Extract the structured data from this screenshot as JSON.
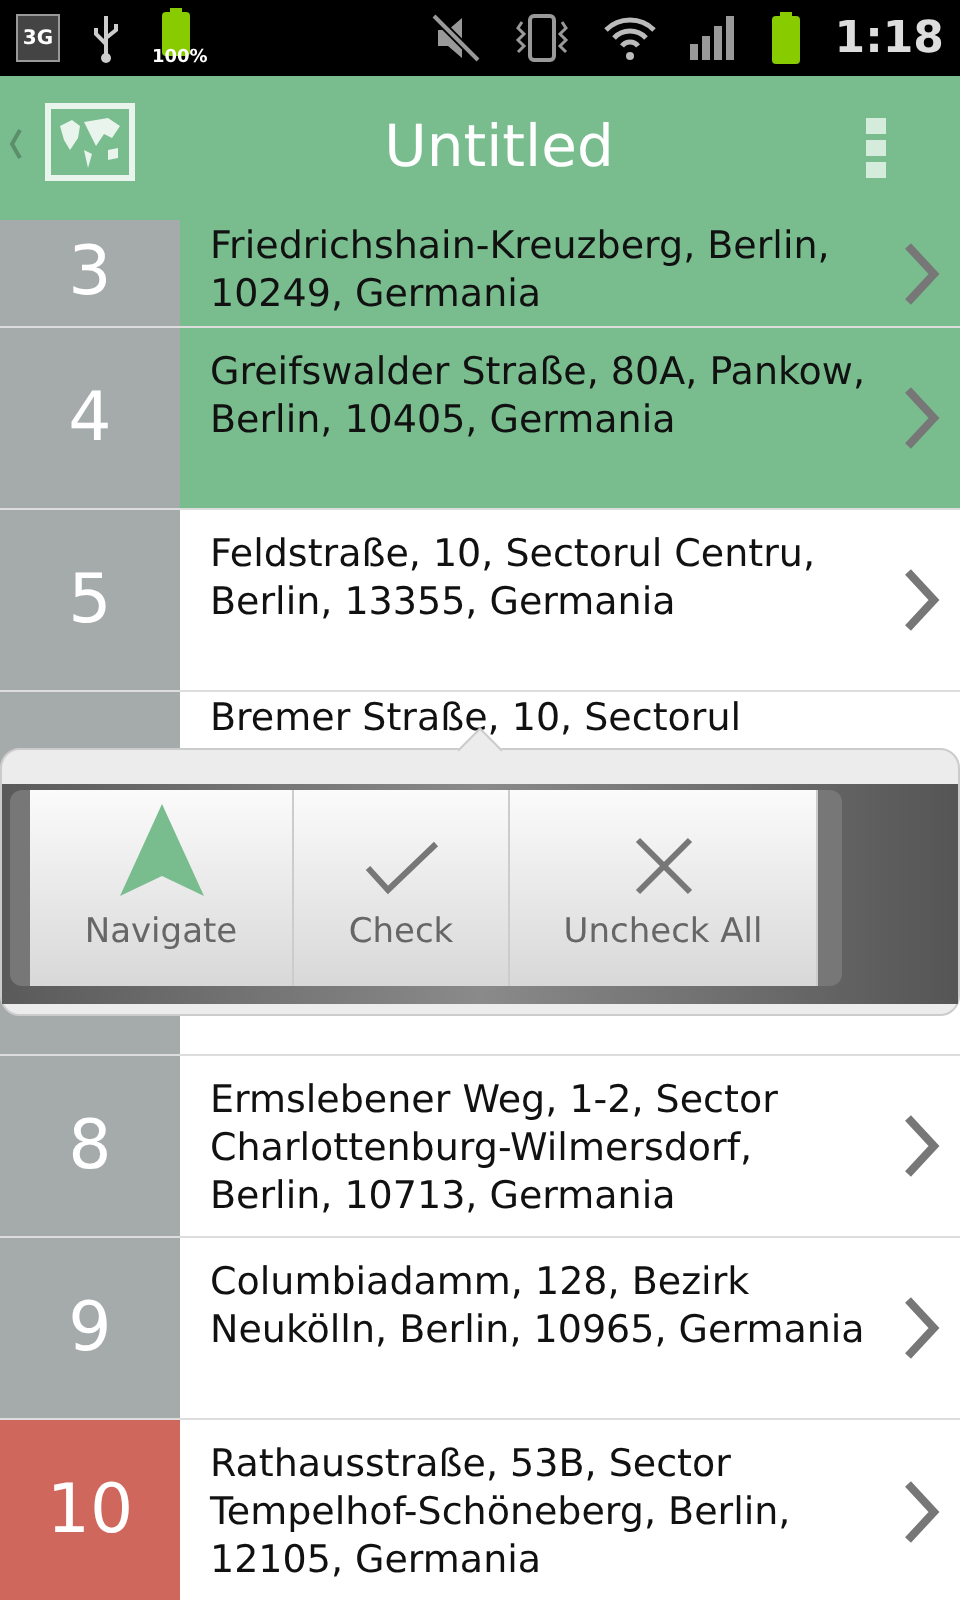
{
  "status_bar": {
    "network": "3G",
    "battery_text": "100%",
    "time": "1:18"
  },
  "app_bar": {
    "title": "Untitled"
  },
  "rows": [
    {
      "number": "3",
      "lines": [
        "Friedrichshain-Kreuzberg, Berlin,",
        "10249, Germania"
      ],
      "selected": true,
      "color": "#a5abab"
    },
    {
      "number": "4",
      "lines": [
        "Greifswalder Straße, 80A, Pankow,",
        "Berlin, 10405, Germania"
      ],
      "selected": true,
      "color": "#a5abab"
    },
    {
      "number": "5",
      "lines": [
        "Feldstraße, 10, Sectorul Centru,",
        "Berlin, 13355, Germania"
      ],
      "selected": false,
      "color": "#a5abab"
    },
    {
      "lines": [
        "Bremer Straße, 10, Sectorul"
      ],
      "color": "#a5abab",
      "kind": "covered"
    },
    {
      "number": "8",
      "lines": [
        "Ermslebener Weg, 1-2, Sector",
        "Charlottenburg-Wilmersdorf,",
        "Berlin, 10713, Germania"
      ],
      "selected": false,
      "color": "#a5abab"
    },
    {
      "number": "9",
      "lines": [
        "Columbiadamm, 128, Bezirk",
        "Neukölln, Berlin, 10965, Germania"
      ],
      "selected": false,
      "color": "#a5abab"
    },
    {
      "number": "10",
      "lines": [
        "Rathausstraße, 53B, Sector",
        "Tempelhof-Schöneberg, Berlin,",
        "12105, Germania"
      ],
      "selected": false,
      "color": "#d0675c"
    }
  ],
  "popup": {
    "actions": [
      {
        "label": "Navigate",
        "kind": "navigate"
      },
      {
        "label": "Check",
        "kind": "check"
      },
      {
        "label": "Uncheck All",
        "kind": "uncheck"
      }
    ]
  }
}
